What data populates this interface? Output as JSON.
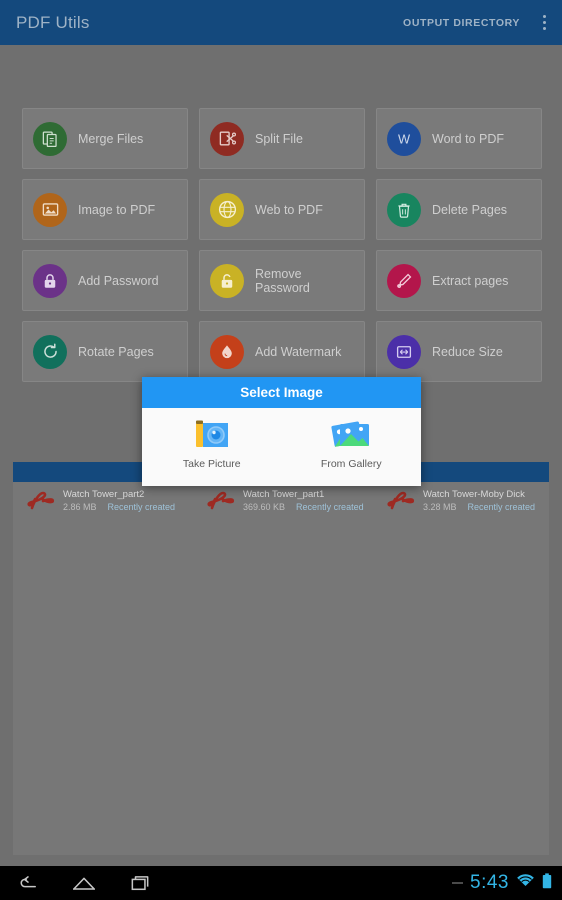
{
  "appbar": {
    "title": "PDF Utils",
    "action_label": "OUTPUT DIRECTORY",
    "overflow_icon": "more-vert-icon",
    "bg_color": "#14497d"
  },
  "grid": {
    "tiles": [
      {
        "label": "Merge Files",
        "icon": "merge-files-icon",
        "color": "#2f6b34"
      },
      {
        "label": "Split File",
        "icon": "split-file-icon",
        "color": "#8f2b22"
      },
      {
        "label": "Word to PDF",
        "icon": "word-to-pdf-icon",
        "color": "#1f4e9c"
      },
      {
        "label": "Image to PDF",
        "icon": "image-to-pdf-icon",
        "color": "#b0651a"
      },
      {
        "label": "Web to PDF",
        "icon": "web-to-pdf-icon",
        "color": "#c9b225"
      },
      {
        "label": "Delete Pages",
        "icon": "delete-pages-icon",
        "color": "#18855f"
      },
      {
        "label": "Add Password",
        "icon": "add-password-icon",
        "color": "#6b3288"
      },
      {
        "label": "Remove Password",
        "icon": "remove-password-icon",
        "color": "#c9b225"
      },
      {
        "label": "Extract pages",
        "icon": "extract-pages-icon",
        "color": "#b3164b"
      },
      {
        "label": "Rotate Pages",
        "icon": "rotate-pages-icon",
        "color": "#11705c"
      },
      {
        "label": "Add Watermark",
        "icon": "add-watermark-icon",
        "color": "#c4401a"
      },
      {
        "label": "Reduce Size",
        "icon": "reduce-size-icon",
        "color": "#4b2fa8"
      }
    ]
  },
  "file_list": {
    "header_bg": "#14497d",
    "files": [
      {
        "name": "Watch Tower_part2",
        "size": "2.86 MB",
        "status": "Recently created",
        "icon": "pdf-file-icon"
      },
      {
        "name": "Watch Tower_part1",
        "size": "369.60 KB",
        "status": "Recently created",
        "icon": "pdf-file-icon"
      },
      {
        "name": "Watch Tower-Moby Dick",
        "size": "3.28 MB",
        "status": "Recently created",
        "icon": "pdf-file-icon"
      }
    ]
  },
  "dialog": {
    "title": "Select Image",
    "header_color": "#2196f3",
    "options": [
      {
        "label": "Take Picture",
        "icon": "camera-icon"
      },
      {
        "label": "From Gallery",
        "icon": "gallery-icon"
      }
    ]
  },
  "navbar": {
    "back_icon": "back-icon",
    "home_icon": "home-icon",
    "recents_icon": "recents-icon",
    "dash_icon": "dash-icon",
    "clock": "5:43",
    "wifi_icon": "wifi-icon",
    "battery_icon": "battery-icon",
    "accent_color": "#33b5e5"
  }
}
